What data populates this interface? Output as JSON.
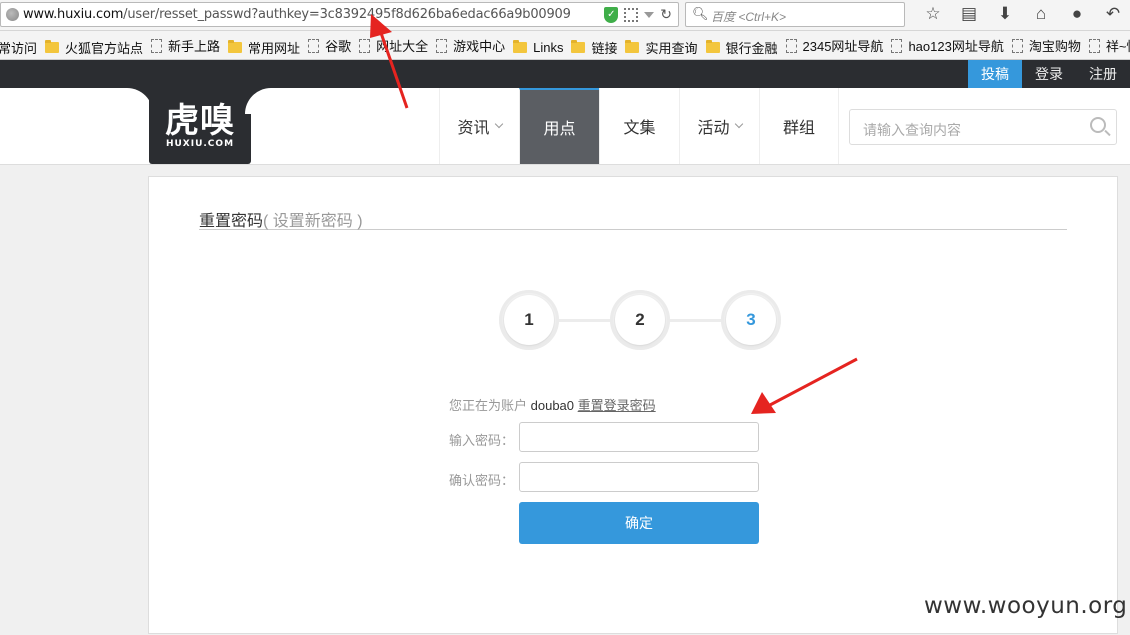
{
  "browser": {
    "url_host": "www.huxiu.com",
    "url_path": "/user/resset_passwd?authkey=3c8392495f8d626ba6edac66a9b00909",
    "search_placeholder": "百度 <Ctrl+K>",
    "bookmarks": [
      {
        "label": "常访问",
        "icon": "none"
      },
      {
        "label": "火狐官方站点",
        "icon": "folder"
      },
      {
        "label": "新手上路",
        "icon": "page"
      },
      {
        "label": "常用网址",
        "icon": "folder"
      },
      {
        "label": "谷歌",
        "icon": "page"
      },
      {
        "label": "网址大全",
        "icon": "page"
      },
      {
        "label": "游戏中心",
        "icon": "page"
      },
      {
        "label": "Links",
        "icon": "folder"
      },
      {
        "label": "链接",
        "icon": "folder"
      },
      {
        "label": "实用查询",
        "icon": "folder"
      },
      {
        "label": "银行金融",
        "icon": "folder"
      },
      {
        "label": "2345网址导航",
        "icon": "page"
      },
      {
        "label": "hao123网址导航",
        "icon": "page"
      },
      {
        "label": "淘宝购物",
        "icon": "page"
      },
      {
        "label": "祥~怡 [http",
        "icon": "page"
      }
    ],
    "toolbar_icons": [
      "star-icon",
      "reading-list-icon",
      "download-icon",
      "home-icon",
      "chat-icon",
      "back-icon"
    ]
  },
  "site": {
    "topbar": {
      "contribute": "投稿",
      "login": "登录",
      "register": "注册"
    },
    "logo": {
      "main": "虎嗅",
      "sub": "HUXIU.COM"
    },
    "nav": [
      {
        "label": "资讯",
        "dropdown": true
      },
      {
        "label": "用点",
        "dropdown": false,
        "active": true
      },
      {
        "label": "文集",
        "dropdown": false
      },
      {
        "label": "活动",
        "dropdown": true
      },
      {
        "label": "群组",
        "dropdown": false
      }
    ],
    "search_placeholder": "请输入查询内容",
    "accent_color": "#3598dc"
  },
  "reset": {
    "title": "重置密码",
    "subtitle": "( 设置新密码 )",
    "steps": [
      "1",
      "2",
      "3"
    ],
    "current_step": 3,
    "notice_prefix": "您正在为账户",
    "account": "douba0",
    "notice_link": "重置登录密码",
    "password_label": "输入密码：",
    "password_value": "",
    "confirm_label": "确认密码：",
    "confirm_value": "",
    "submit_label": "确定"
  },
  "watermark": "www.wooyun.org"
}
